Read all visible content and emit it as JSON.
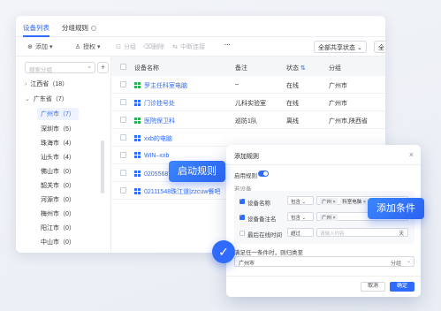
{
  "tabs": [
    "设备列表",
    "分组规则"
  ],
  "toolbar": {
    "add": "添加",
    "authorize": "授权",
    "group": "分组",
    "delete": "删除",
    "disconnect": "中断连接",
    "more": "···",
    "share_filter": "全部共享状态",
    "all": "全"
  },
  "sidebar": {
    "search_placeholder": "搜索分组",
    "items": [
      {
        "label": "江西省（18）",
        "caret": "›"
      },
      {
        "label": "广东省（7）",
        "caret": "⌄"
      },
      {
        "label": "广州市（7）"
      },
      {
        "label": "深圳市（5）"
      },
      {
        "label": "珠海市（4）"
      },
      {
        "label": "汕头市（4）"
      },
      {
        "label": "佛山市（0）"
      },
      {
        "label": "韶关市（0）"
      },
      {
        "label": "河源市（0）"
      },
      {
        "label": "梅州市（0）"
      },
      {
        "label": "阳江市（0）"
      },
      {
        "label": "中山市（0）"
      }
    ]
  },
  "table": {
    "headers": [
      "设备名称",
      "备注",
      "状态",
      "分组"
    ],
    "rows": [
      {
        "name": "罗主任科室电脑",
        "note": "–",
        "status": "在线",
        "group": "广州市",
        "icon": "green"
      },
      {
        "name": "门诊挂号处",
        "note": "儿科实验室",
        "status": "在线",
        "group": "广州市",
        "icon": "blue"
      },
      {
        "name": "医院保卫科",
        "note": "巡防1队",
        "status": "离线",
        "group": "广州市,陕西省",
        "icon": "green"
      },
      {
        "name": "xxb的电脑",
        "note": "",
        "status": "",
        "group": "",
        "icon": "blue"
      },
      {
        "name": "WIN–xxb",
        "note": "",
        "status": "",
        "group": "",
        "icon": "blue"
      },
      {
        "name": "02055687花城汇|潮汕肠…",
        "note": "",
        "status": "",
        "group": "",
        "icon": "blue"
      },
      {
        "name": "02111548珠江道|zzcuw餐吧",
        "note": "",
        "status": "",
        "group": "",
        "icon": "blue"
      }
    ]
  },
  "dialog": {
    "title": "添加规则",
    "enable_label": "启用规则",
    "section_label": "若设备",
    "conditions": [
      {
        "label": "设备名称",
        "op": "包含",
        "chips": [
          "广州",
          "科室电脑"
        ],
        "checked": true
      },
      {
        "label": "设备备注名",
        "op": "包含",
        "chips": [
          "广州"
        ],
        "checked": true
      },
      {
        "label": "最后在线时间",
        "op": "超过",
        "placeholder": "请输入内容",
        "unit": "天",
        "checked": false
      }
    ],
    "result_label": "满足任一条件时，则归类至",
    "result_value": "广州市",
    "result_unit": "分组",
    "cancel": "取消",
    "ok": "确定"
  },
  "callouts": {
    "enable_rule": "启动规则",
    "add_condition": "添加条件"
  },
  "colors": {
    "accent": "#2f6bff",
    "green": "#2fae5a"
  }
}
